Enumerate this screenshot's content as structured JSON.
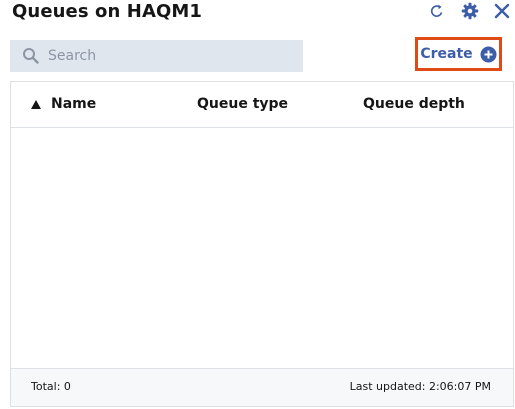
{
  "header": {
    "title": "Queues on HAQM1",
    "icons": [
      "refresh-icon",
      "gear-icon",
      "close-icon"
    ],
    "accent_color": "#3d5da8"
  },
  "search": {
    "placeholder": "Search",
    "value": ""
  },
  "create": {
    "label": "Create",
    "highlight_color": "#e04a17"
  },
  "table": {
    "columns": [
      {
        "label": "Name",
        "sorted": "ascending"
      },
      {
        "label": "Queue type"
      },
      {
        "label": "Queue depth"
      }
    ],
    "rows": []
  },
  "footer": {
    "total": "Total: 0",
    "last_updated": "Last updated: 2:06:07 PM"
  }
}
